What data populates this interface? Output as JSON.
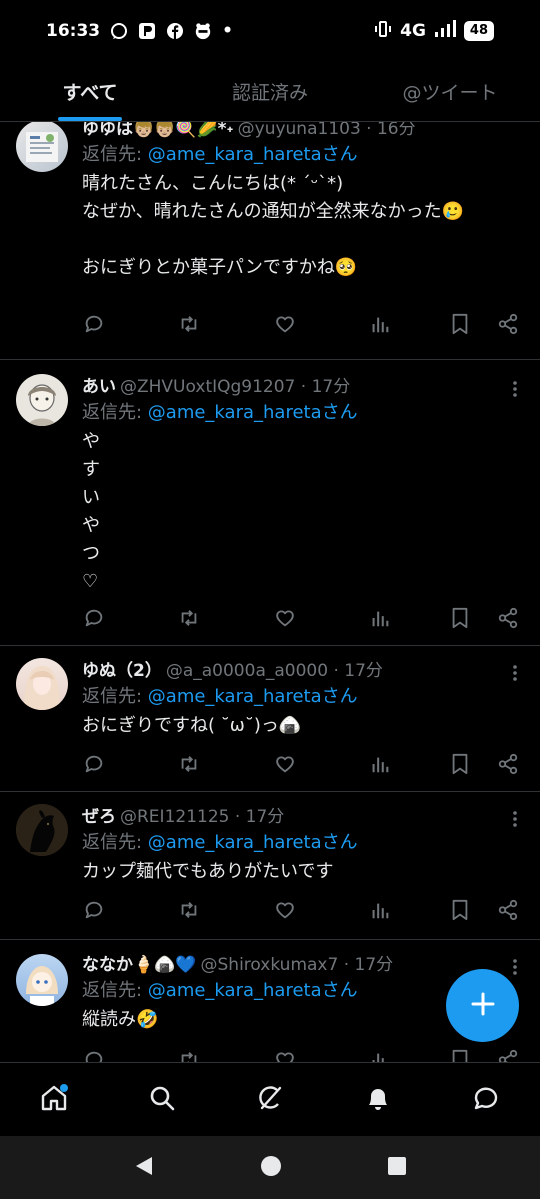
{
  "status_bar": {
    "time": "16:33",
    "network": "4G",
    "battery": "48",
    "dot": "•"
  },
  "tabs": [
    {
      "label": "すべて",
      "active": true
    },
    {
      "label": "認証済み",
      "active": false
    },
    {
      "label": "@ツイート",
      "active": false
    }
  ],
  "reply_prefix": "返信先: ",
  "reply_suffix": "さん",
  "tweets": [
    {
      "name": "ゆゆは👦🏼👦🏼🍭🌽*˖",
      "handle": "@yuyuna1103 · 16分",
      "reply_to": "@ame_kara_hareta",
      "text": "晴れたさん、こんにちは(* ˊᵕˋ*)\nなぜか、晴れたさんの通知が全然来なかった🥲\n\nおにぎりとか菓子パンですかね🥺"
    },
    {
      "name": "あい",
      "handle": "@ZHVUoxtIQg91207 · 17分",
      "reply_to": "@ame_kara_hareta",
      "text": "や\nす\nい\nや\nつ\n♡"
    },
    {
      "name": "ゆぬ（2）",
      "handle": "@a_a0000a_a0000 · 17分",
      "reply_to": "@ame_kara_hareta",
      "text": "おにぎりですね( ˘ω˘)っ🍙"
    },
    {
      "name": "ぜろ",
      "handle": "@REI121125 · 17分",
      "reply_to": "@ame_kara_hareta",
      "text": "カップ麺代でもありがたいです"
    },
    {
      "name": "ななか🍦🍙💙",
      "handle": "@Shiroxkumax7 · 17分",
      "reply_to": "@ame_kara_hareta",
      "text": "縦読み🤣"
    }
  ],
  "icons": {
    "reply": "reply-icon",
    "retweet": "retweet-icon",
    "like": "heart-icon",
    "views": "views-icon",
    "bookmark": "bookmark-icon",
    "share": "share-icon",
    "more": "more-vertical-icon"
  },
  "colors": {
    "accent": "#1d9bf0",
    "background": "#000000",
    "text": "#e7e9ea",
    "muted": "#71767b",
    "divider": "#2f3336"
  }
}
